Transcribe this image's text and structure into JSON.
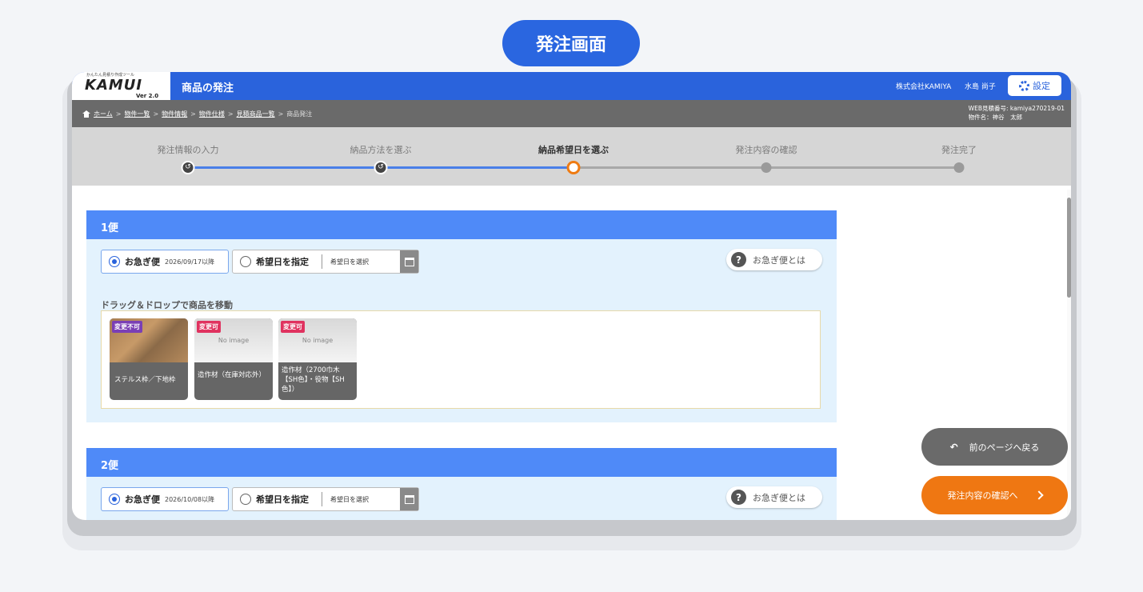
{
  "page_title": "発注画面",
  "header": {
    "logo_tagline": "かんたん見積り作成ツール",
    "logo_name": "KAMUI",
    "logo_version": "Ver 2.0",
    "title": "商品の発注",
    "company": "株式会社KAMIYA",
    "user": "水島 尚子",
    "settings_label": "設定"
  },
  "breadcrumb": {
    "items": [
      "ホーム",
      "物件一覧",
      "物件情報",
      "物件仕様",
      "見積商品一覧"
    ],
    "current": "商品発注",
    "separator": ">",
    "web_estimate_no": "WEB見積番号: kamiya270219-01",
    "property_name": "物件名：神谷　太郎"
  },
  "steps": [
    {
      "label": "発注情報の入力",
      "state": "done"
    },
    {
      "label": "納品方法を選ぶ",
      "state": "done"
    },
    {
      "label": "納品希望日を選ぶ",
      "state": "current"
    },
    {
      "label": "発注内容の確認",
      "state": "todo"
    },
    {
      "label": "発注完了",
      "state": "todo"
    }
  ],
  "shipments": [
    {
      "title": "1便",
      "urgent_label": "お急ぎ便",
      "urgent_date": "2026/09/17以降",
      "pick_label": "希望日を指定",
      "pick_placeholder": "希望日を選択",
      "help_label": "お急ぎ便とは",
      "help_icon": "?",
      "dnd_label": "ドラッグ＆ドロップで商品を移動",
      "items": [
        {
          "badge": "変更不可",
          "name": "ステルス枠／下地枠",
          "has_photo": true
        },
        {
          "badge": "変更可",
          "name": "造作材（在庫対応外）",
          "no_image": "No image"
        },
        {
          "badge": "変更可",
          "name": "造作材（2700巾木【SH色】・役物【SH色】）",
          "no_image": "No image"
        }
      ]
    },
    {
      "title": "2便",
      "urgent_label": "お急ぎ便",
      "urgent_date": "2026/10/08以降",
      "pick_label": "希望日を指定",
      "pick_placeholder": "希望日を選択",
      "help_label": "お急ぎ便とは",
      "help_icon": "?"
    }
  ],
  "buttons": {
    "back": "前のページへ戻る",
    "next": "発注内容の確認へ"
  },
  "colors": {
    "primary": "#2a63dc",
    "accent": "#ef7712",
    "bin_header": "#4f8af8",
    "badge_locked": "#7a3fb5",
    "badge_changeable": "#e0325f"
  }
}
